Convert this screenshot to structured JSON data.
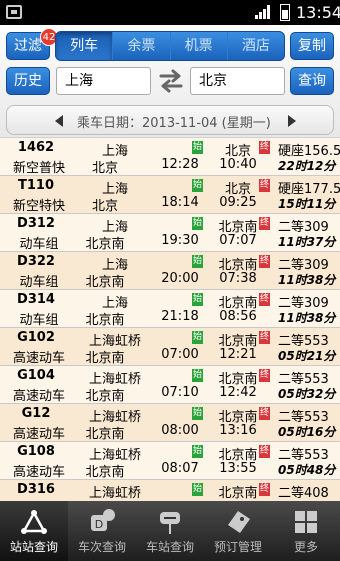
{
  "status_bar": {
    "time": "13:54"
  },
  "header": {
    "filter_label": "过滤",
    "filter_badge": "42",
    "copy_label": "复制",
    "history_label": "历史",
    "query_label": "查询",
    "tabs": [
      {
        "label": "列车",
        "active": true
      },
      {
        "label": "余票",
        "active": false
      },
      {
        "label": "机票",
        "active": false
      },
      {
        "label": "酒店",
        "active": false
      }
    ],
    "from_city": "上海",
    "to_city": "北京",
    "date_text": "乘车日期：2013-11-04 (星期一)"
  },
  "tags": {
    "start": "始",
    "end": "终"
  },
  "trains": [
    {
      "num": "1462",
      "type": "新空普快",
      "from": "上海",
      "from_station": "北京",
      "to": "北京",
      "dep": "12:28",
      "arr": "10:40",
      "seat": "硬座156.5",
      "duration": "22时12分"
    },
    {
      "num": "T110",
      "type": "新空特快",
      "from": "上海",
      "from_station": "北京",
      "to": "北京",
      "dep": "18:14",
      "arr": "09:25",
      "seat": "硬座177.5",
      "duration": "15时11分"
    },
    {
      "num": "D312",
      "type": "动车组",
      "from": "上海",
      "from_station": "北京南",
      "to": "北京南",
      "dep": "19:30",
      "arr": "07:07",
      "seat": "二等309",
      "duration": "11时37分"
    },
    {
      "num": "D322",
      "type": "动车组",
      "from": "上海",
      "from_station": "北京南",
      "to": "北京南",
      "dep": "20:00",
      "arr": "07:38",
      "seat": "二等309",
      "duration": "11时38分"
    },
    {
      "num": "D314",
      "type": "动车组",
      "from": "上海",
      "from_station": "北京南",
      "to": "北京南",
      "dep": "21:18",
      "arr": "08:56",
      "seat": "二等309",
      "duration": "11时38分"
    },
    {
      "num": "G102",
      "type": "高速动车",
      "from": "上海虹桥",
      "from_station": "北京南",
      "to": "北京南",
      "dep": "07:00",
      "arr": "12:21",
      "seat": "二等553",
      "duration": "05时21分"
    },
    {
      "num": "G104",
      "type": "高速动车",
      "from": "上海虹桥",
      "from_station": "北京南",
      "to": "北京南",
      "dep": "07:10",
      "arr": "12:42",
      "seat": "二等553",
      "duration": "05时32分"
    },
    {
      "num": "G12",
      "type": "高速动车",
      "from": "上海虹桥",
      "from_station": "北京南",
      "to": "北京南",
      "dep": "08:00",
      "arr": "13:16",
      "seat": "二等553",
      "duration": "05时16分"
    },
    {
      "num": "G108",
      "type": "高速动车",
      "from": "上海虹桥",
      "from_station": "北京南",
      "to": "北京南",
      "dep": "08:07",
      "arr": "13:55",
      "seat": "二等553",
      "duration": "05时48分"
    },
    {
      "num": "D316",
      "type": "",
      "from": "上海虹桥",
      "from_station": "",
      "to": "北京南",
      "dep": "",
      "arr": "",
      "seat": "二等408",
      "duration": ""
    }
  ],
  "bottom_nav": [
    {
      "label": "站站查询",
      "icon": "route-icon",
      "active": true
    },
    {
      "label": "车次查询",
      "icon": "train-number-icon",
      "active": false,
      "badge": "1"
    },
    {
      "label": "车站查询",
      "icon": "station-icon",
      "active": false
    },
    {
      "label": "预订管理",
      "icon": "ticket-tag-icon",
      "active": false
    },
    {
      "label": "更多",
      "icon": "grid-icon",
      "active": false
    }
  ]
}
